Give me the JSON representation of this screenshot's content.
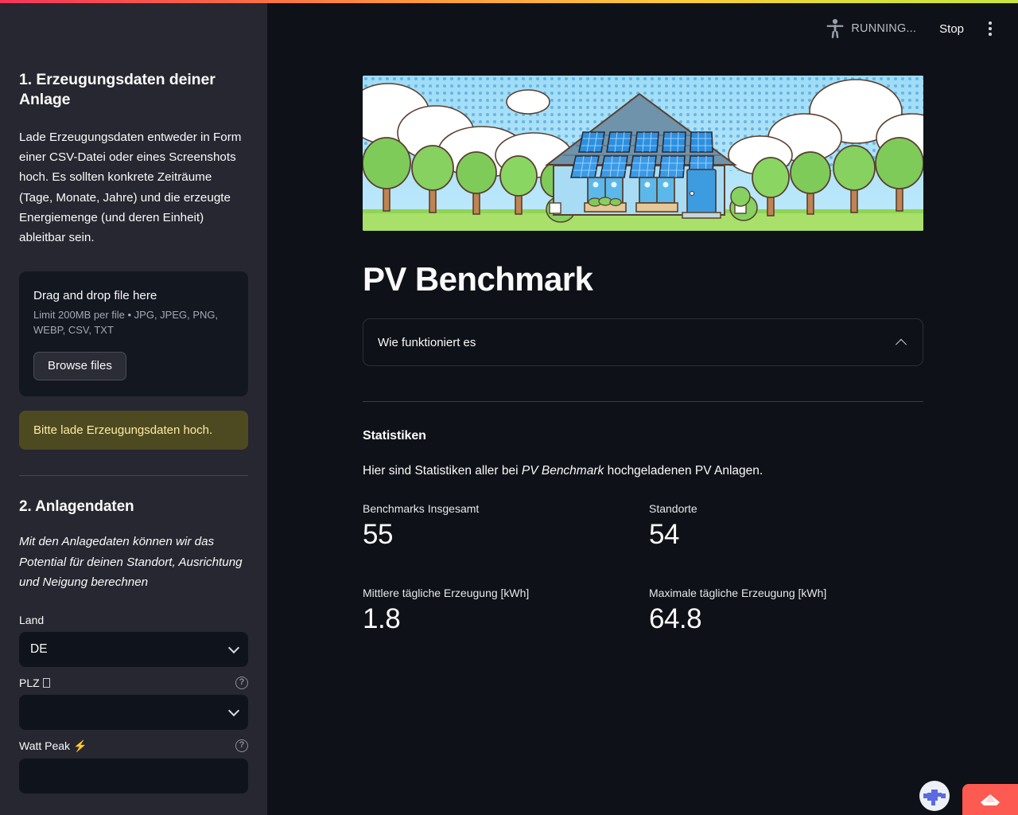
{
  "toolbar": {
    "status_text": "RUNNING...",
    "stop_label": "Stop",
    "running_icon": "running-man-icon",
    "menu_icon": "kebab-menu-icon"
  },
  "sidebar": {
    "step1_title": "1. Erzeugungsdaten deiner Anlage",
    "step1_desc": "Lade Erzeugungsdaten entweder in Form einer CSV-Datei oder eines Screenshots hoch. Es sollten konkrete Zeiträume (Tage, Monate, Jahre) und die erzeugte Energiemenge (und deren Einheit) ableitbar sein.",
    "uploader": {
      "drop_title": "Drag and drop file here",
      "limits": "Limit 200MB per file • JPG, JPEG, PNG, WEBP, CSV, TXT",
      "browse_label": "Browse files"
    },
    "warning": "Bitte lade Erzeugungsdaten hoch.",
    "step2_title": "2. Anlagendaten",
    "step2_desc": "Mit den Anlagedaten können wir das Potential für deinen Standort, Ausrichtung und Neigung berechnen",
    "fields": {
      "land": {
        "label": "Land",
        "value": "DE"
      },
      "plz": {
        "label": "PLZ",
        "label_glyph": "tofu-missing-glyph",
        "value": "",
        "help_icon": "question-mark-icon"
      },
      "watt_peak": {
        "label": "Watt Peak ⚡",
        "value": "",
        "help_icon": "question-mark-icon"
      }
    }
  },
  "main": {
    "hero_alt": "cartoon-house-with-solar-panels",
    "title": "PV Benchmark",
    "expander_label": "Wie funktioniert es",
    "section_title": "Statistiken",
    "section_desc_before": "Hier sind Statistiken aller bei ",
    "section_desc_em": "PV Benchmark",
    "section_desc_after": " hochgeladenen PV Anlagen.",
    "metrics": [
      {
        "label": "Benchmarks Insgesamt",
        "value": "55"
      },
      {
        "label": "Standorte",
        "value": "54"
      },
      {
        "label": "Mittlere tägliche Erzeugung [kWh]",
        "value": "1.8"
      },
      {
        "label": "Maximale tägliche Erzeugung [kWh]",
        "value": "64.8"
      }
    ]
  },
  "fabs": {
    "badge_icon": "globe-badge-icon",
    "deploy_icon": "paper-boat-icon"
  },
  "colors": {
    "sidebar_bg": "#262730",
    "main_bg": "#0e1117",
    "warning_bg": "#4d4a22",
    "warning_text": "#ffeaa0",
    "deploy_red": "#fd5a52",
    "text": "#fafafa"
  }
}
